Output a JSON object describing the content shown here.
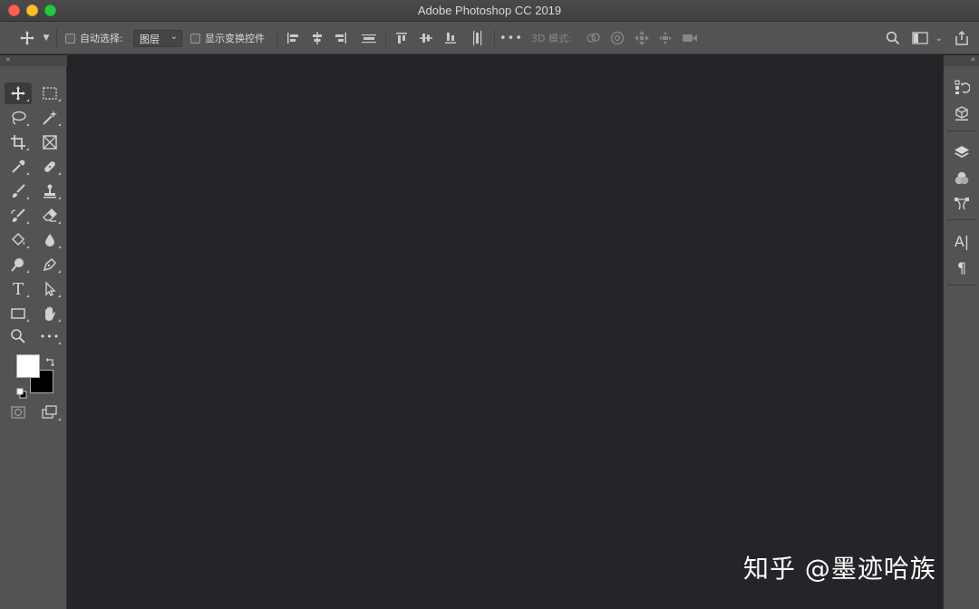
{
  "window": {
    "title": "Adobe Photoshop CC 2019"
  },
  "options_bar": {
    "auto_select_label": "自动选择:",
    "auto_select_target": "图层",
    "show_transform_label": "显示变换控件",
    "mode_3d_label": "3D 模式:"
  },
  "tools": [
    {
      "name": "move-tool",
      "icon": "move-icon",
      "selected": true
    },
    {
      "name": "rectangular-marquee-tool",
      "icon": "marquee-icon"
    },
    {
      "name": "lasso-tool",
      "icon": "lasso-icon"
    },
    {
      "name": "magic-wand-tool",
      "icon": "magic-wand-icon"
    },
    {
      "name": "crop-tool",
      "icon": "crop-icon"
    },
    {
      "name": "frame-tool",
      "icon": "frame-icon"
    },
    {
      "name": "eyedropper-tool",
      "icon": "eyedropper-icon"
    },
    {
      "name": "healing-brush-tool",
      "icon": "bandage-icon"
    },
    {
      "name": "brush-tool",
      "icon": "brush-icon"
    },
    {
      "name": "clone-stamp-tool",
      "icon": "stamp-icon"
    },
    {
      "name": "history-brush-tool",
      "icon": "history-brush-icon"
    },
    {
      "name": "eraser-tool",
      "icon": "eraser-icon"
    },
    {
      "name": "paint-bucket-tool",
      "icon": "bucket-icon"
    },
    {
      "name": "blur-tool",
      "icon": "drop-icon"
    },
    {
      "name": "dodge-tool",
      "icon": "dodge-icon"
    },
    {
      "name": "pen-tool",
      "icon": "pen-icon"
    },
    {
      "name": "type-tool",
      "icon": "type-icon",
      "glyph": "T"
    },
    {
      "name": "path-selection-tool",
      "icon": "arrow-icon"
    },
    {
      "name": "rectangle-tool",
      "icon": "rectangle-icon"
    },
    {
      "name": "hand-tool",
      "icon": "hand-icon"
    },
    {
      "name": "zoom-tool",
      "icon": "magnifier-icon"
    },
    {
      "name": "edit-toolbar",
      "icon": "more-icon",
      "glyph": "•••"
    }
  ],
  "colors": {
    "foreground": "#ffffff",
    "background": "#000000",
    "canvas": "#262428",
    "panel": "#535353"
  },
  "right_panels": [
    {
      "name": "history-panel",
      "icon": "history-icon"
    },
    {
      "name": "3d-panel",
      "icon": "cube-icon"
    },
    {
      "name": "layers-panel",
      "icon": "layers-icon"
    },
    {
      "name": "channels-panel",
      "icon": "channels-icon"
    },
    {
      "name": "paths-panel",
      "icon": "paths-icon"
    },
    {
      "name": "character-panel",
      "icon": "character-icon",
      "glyph": "A|"
    },
    {
      "name": "paragraph-panel",
      "icon": "paragraph-icon",
      "glyph": "¶"
    }
  ],
  "watermark": "知乎 @墨迹哈族"
}
